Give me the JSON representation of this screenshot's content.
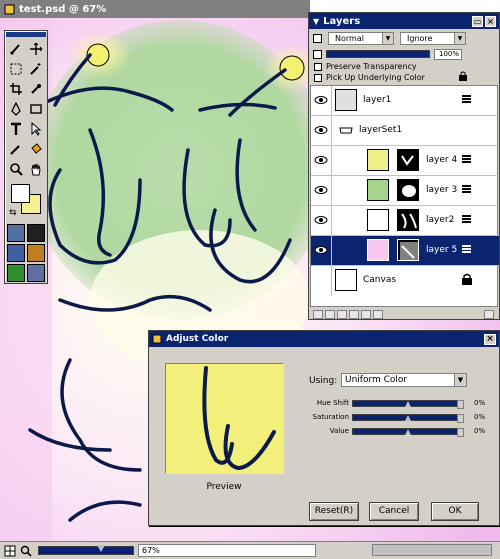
{
  "document": {
    "title": "test.psd @ 67%",
    "zoom_label": "67%"
  },
  "layers_panel": {
    "title": "Layers",
    "blend_mode": "Normal",
    "mode_option": "Ignore",
    "opacity": "100%",
    "preserve_transparency_label": "Preserve Transparency",
    "pick_up_label": "Pick Up Underlying Color",
    "layers": [
      {
        "name": "layer1",
        "thumb_color": "#e0e0e0"
      },
      {
        "name": "layerSet1",
        "thumb_color": "#ffffff"
      },
      {
        "name": "layer 4",
        "thumb_color": "#f0f08a"
      },
      {
        "name": "layer 3",
        "thumb_color": "#a6d48a"
      },
      {
        "name": "layer2",
        "thumb_color": "#ffffff"
      },
      {
        "name": "layer 5",
        "thumb_color": "#f8c8f0"
      },
      {
        "name": "Canvas",
        "thumb_color": "#ffffff"
      }
    ]
  },
  "dialog": {
    "title": "Adjust Color",
    "using_label": "Using:",
    "using_value": "Uniform Color",
    "preview_label": "Preview",
    "sliders": [
      {
        "label": "Hue Shift",
        "value": "0%"
      },
      {
        "label": "Saturation",
        "value": "0%"
      },
      {
        "label": "Value",
        "value": "0%"
      }
    ],
    "reset_label": "Reset(R)",
    "cancel_label": "Cancel",
    "ok_label": "OK"
  },
  "colors": {
    "title_active": "#0a2470",
    "title_inactive": "#808080",
    "panel": "#d4d0c8",
    "stroke": "#0b1a4a",
    "preview_fill": "#f2f07a"
  }
}
